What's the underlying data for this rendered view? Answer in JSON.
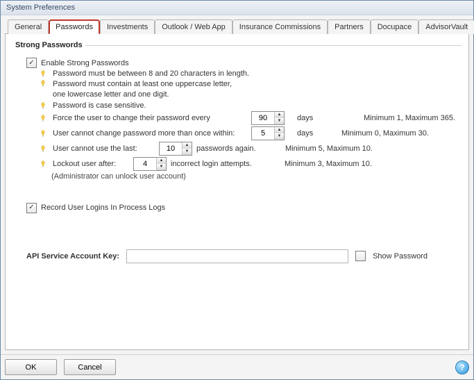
{
  "title": "System Preferences",
  "tabs": [
    "General",
    "Passwords",
    "Investments",
    "Outlook / Web App",
    "Insurance Commissions",
    "Partners",
    "Docupace",
    "AdvisorVault"
  ],
  "active_tab": 1,
  "group_title": "Strong Passwords",
  "enable_label": "Enable Strong Passwords",
  "rules": {
    "length": "Password must be between 8 and 20 characters in length.",
    "complexity_l1": "Password must contain at least one uppercase letter,",
    "complexity_l2": "one lowercase letter and one digit.",
    "case": "Password is case sensitive.",
    "force_pre": "Force the user to change their password every",
    "force_val": "90",
    "force_post": "days",
    "force_hint": "Minimum 1, Maximum 365.",
    "freq_pre": "User cannot change password more than once within:",
    "freq_val": "5",
    "freq_post": "days",
    "freq_hint": "Minimum 0, Maximum 30.",
    "history_pre": "User cannot use the last:",
    "history_val": "10",
    "history_post": "passwords again.",
    "history_hint": "Minimum 5, Maximum 10.",
    "lockout_pre": "Lockout user after:",
    "lockout_val": "4",
    "lockout_post": "incorrect login attempts.",
    "lockout_hint": "Minimum 3, Maximum 10.",
    "admin_note": "(Administrator can unlock user account)"
  },
  "record_logins_label": "Record User Logins In Process Logs",
  "api": {
    "label": "API Service Account Key:",
    "value": "",
    "show_label": "Show Password"
  },
  "buttons": {
    "ok": "OK",
    "cancel": "Cancel"
  }
}
